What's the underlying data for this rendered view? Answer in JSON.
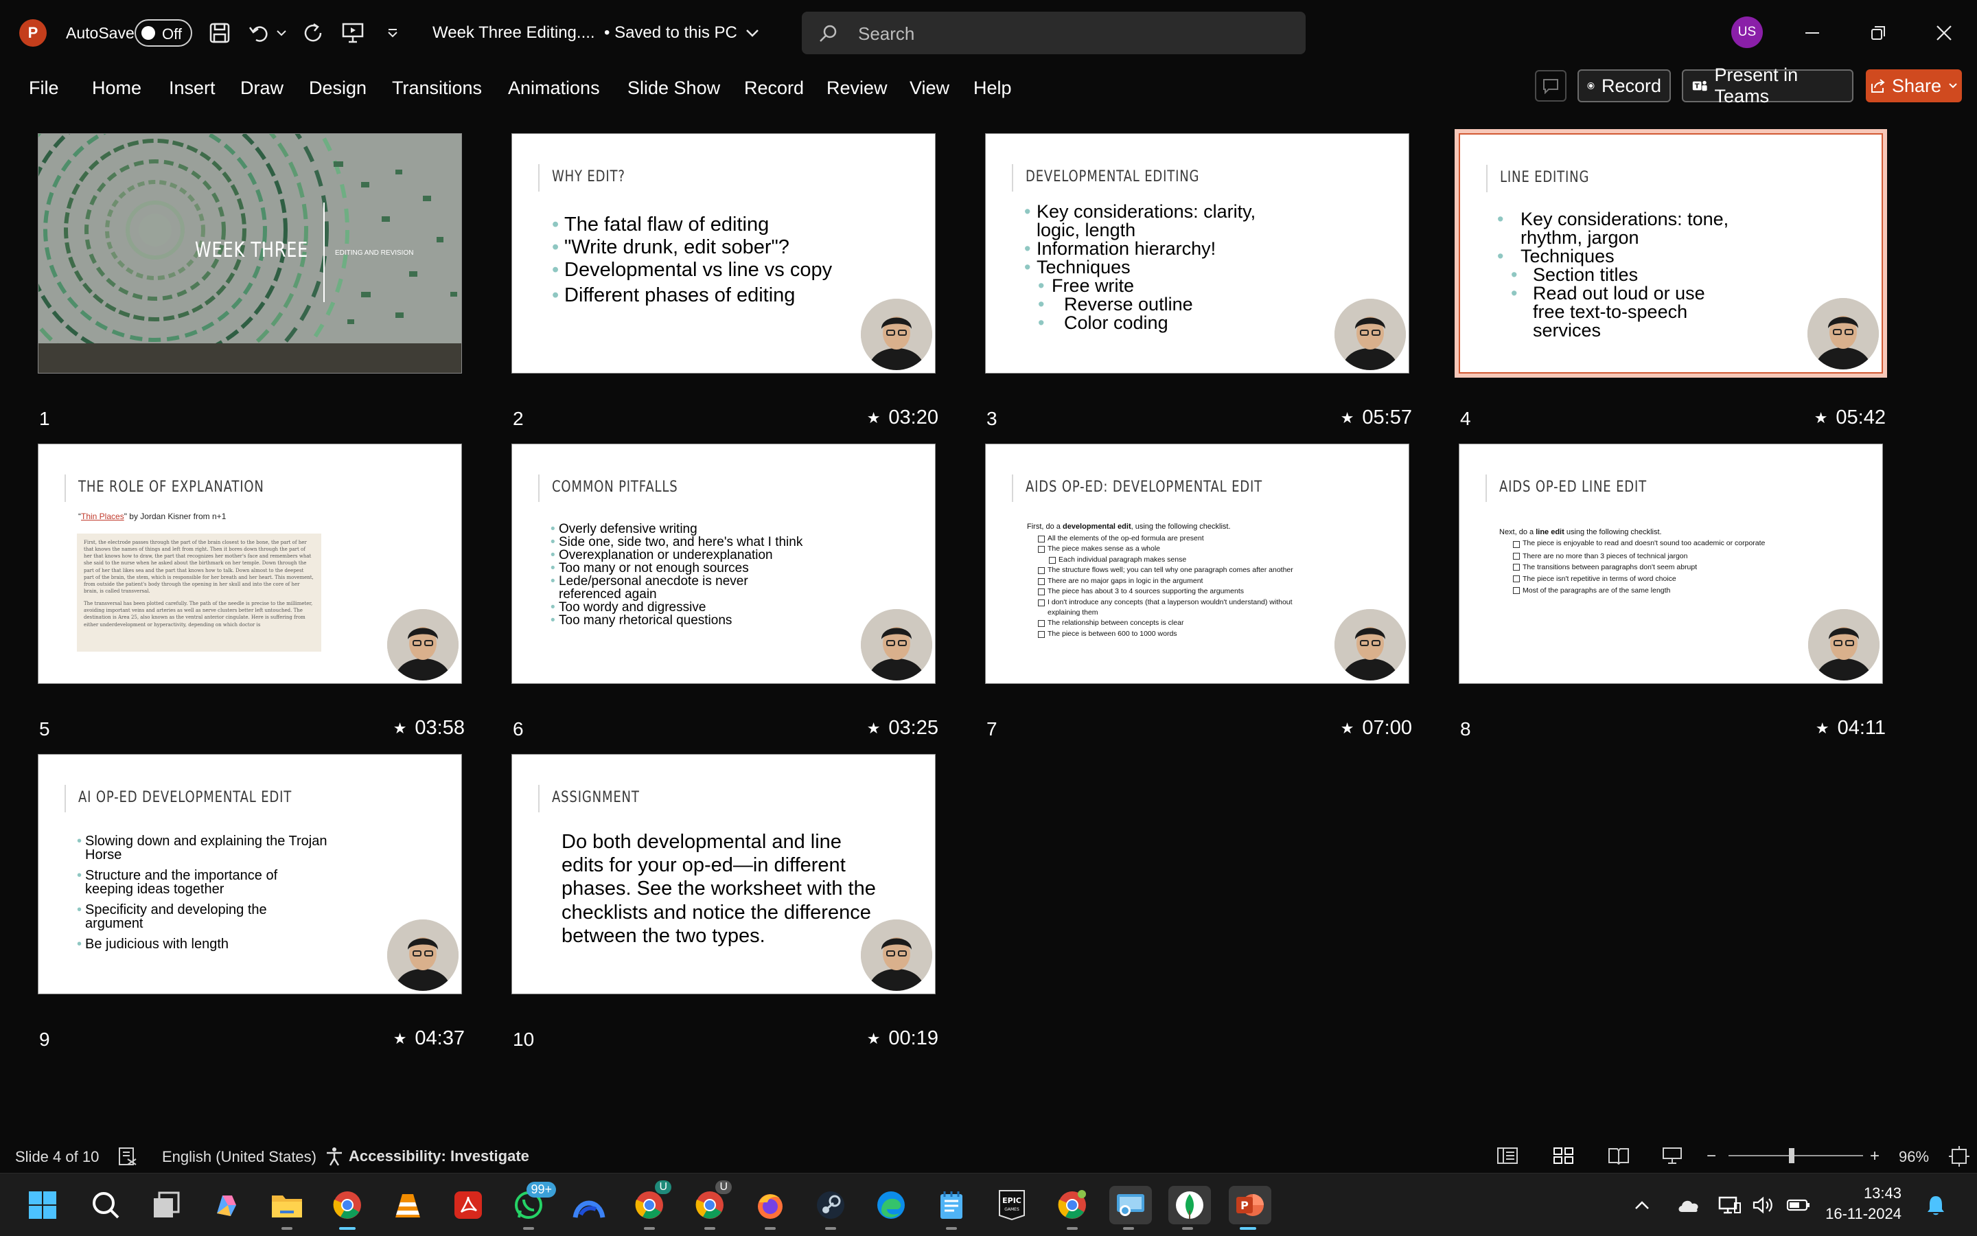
{
  "titlebar": {
    "app_letter": "P",
    "autosave_label": "AutoSave",
    "autosave_state": "Off",
    "doc_title": "Week Three Editing....",
    "saved_status": "• Saved to this PC",
    "search_placeholder": "Search",
    "user_initials": "US"
  },
  "ribbon": {
    "tabs": [
      "File",
      "Home",
      "Insert",
      "Draw",
      "Design",
      "Transitions",
      "Animations",
      "Slide Show",
      "Record",
      "Review",
      "View",
      "Help"
    ],
    "record_label": "Record",
    "present_label": "Present in Teams",
    "share_label": "Share"
  },
  "slides": [
    {
      "number": "1",
      "title": "WEEK THREE",
      "subtitle": "EDITING AND REVISION",
      "timing": ""
    },
    {
      "number": "2",
      "title": "WHY EDIT?",
      "timing": "03:20",
      "bullets": [
        "The fatal flaw of editing",
        "\"Write drunk, edit sober\"?",
        "Developmental vs line vs copy",
        "Different phases of editing"
      ]
    },
    {
      "number": "3",
      "title": "DEVELOPMENTAL EDITING",
      "timing": "05:57",
      "bullets": [
        "Key considerations: clarity, logic, length",
        "Information hierarchy!",
        "Techniques",
        "Free write",
        "Reverse outline",
        "Color coding"
      ]
    },
    {
      "number": "4",
      "title": "LINE EDITING",
      "timing": "05:42",
      "bullets": [
        "Key considerations: tone, rhythm, jargon",
        "Techniques",
        "Section titles",
        "Read out loud or use free text-to-speech services"
      ]
    },
    {
      "number": "5",
      "title": "THE ROLE OF EXPLANATION",
      "timing": "03:58",
      "byline_link": "Thin Places",
      "byline_rest": "\" by Jordan Kisner from n+1",
      "excerpt": "First, the electrode passes through the part of the brain closest to the bone, the part of her that knows the names of things and left from right. Then it bores down through the part of her that knows how to draw, the part that recognizes her mother's face and remembers what she said to the nurse when he asked about the birthmark on her temple. Down through the part of her that likes sea and the part that knows how to talk. Down almost to the deepest part of the brain, the stem, which is responsible for her breath and her heart. This movement, from outside the patient's body through the opening in her skull and into the core of her brain, is called transversal.",
      "excerpt2": "The transversal has been plotted carefully. The path of the needle is precise to the millimeter, avoiding important veins and arteries as well as nerve clusters better left untouched. The destination is Area 25, also known as the ventral anterior cingulate. Here is suffering from either underdevelopment or hyperactivity, depending on which doctor is"
    },
    {
      "number": "6",
      "title": "COMMON PITFALLS",
      "timing": "03:25",
      "bullets": [
        "Overly defensive writing",
        "Side one, side two, and here's what I think",
        "Overexplanation or underexplanation",
        "Too many or not enough sources",
        "Lede/personal anecdote is never referenced again",
        "Too wordy and digressive",
        "Too many rhetorical questions"
      ]
    },
    {
      "number": "7",
      "title": "AIDS OP-ED: DEVELOPMENTAL EDIT",
      "timing": "07:00",
      "intro_pre": "First, do a ",
      "intro_bold": "developmental edit",
      "intro_post": ", using the following checklist.",
      "checks": [
        "All the elements of the op-ed formula are present",
        "The piece makes sense as a whole",
        "Each individual paragraph makes sense",
        "The structure flows well; you can tell why one paragraph comes after another",
        "There are no major gaps in logic in the argument",
        "The piece has about 3 to 4 sources supporting the arguments",
        "I don't introduce any concepts (that a layperson wouldn't understand) without explaining them",
        "The relationship between concepts is clear",
        "The piece is between 600 to 1000 words"
      ]
    },
    {
      "number": "8",
      "title": "AIDS OP-ED LINE EDIT",
      "timing": "04:11",
      "intro_pre": "Next, do a ",
      "intro_bold": "line edit",
      "intro_post": " using the following checklist.",
      "checks": [
        "The piece is enjoyable to read and doesn't sound too academic or corporate",
        "There are no more than 3 pieces of technical jargon",
        "The transitions between paragraphs don't seem abrupt",
        "The piece isn't repetitive in terms of word choice",
        "Most of the paragraphs are of the same length"
      ]
    },
    {
      "number": "9",
      "title": "AI OP-ED DEVELOPMENTAL EDIT",
      "timing": "04:37",
      "bullets": [
        "Slowing down and explaining the Trojan Horse",
        "Structure and the importance of keeping ideas together",
        "Specificity and developing the argument",
        "Be judicious with length"
      ]
    },
    {
      "number": "10",
      "title": "ASSIGNMENT",
      "timing": "00:19",
      "body": "Do both developmental and line edits for your op-ed—in different phases. See the worksheet with the checklists and notice the difference between the two types."
    }
  ],
  "statusbar": {
    "slide_counter": "Slide 4 of 10",
    "language": "English (United States)",
    "accessibility": "Accessibility: Investigate",
    "zoom": "96%"
  },
  "taskbar": {
    "whatsapp_badge": "99+",
    "chrome_badge_1": "U",
    "chrome_badge_2": "U",
    "epic_label": "EPIC\nGAMES",
    "time": "13:43",
    "date": "16-11-2024"
  },
  "colors": {
    "accent_orange": "#d04a1f",
    "selection_border": "#f7c8b9",
    "bullet_teal": "#8fc7c2"
  }
}
